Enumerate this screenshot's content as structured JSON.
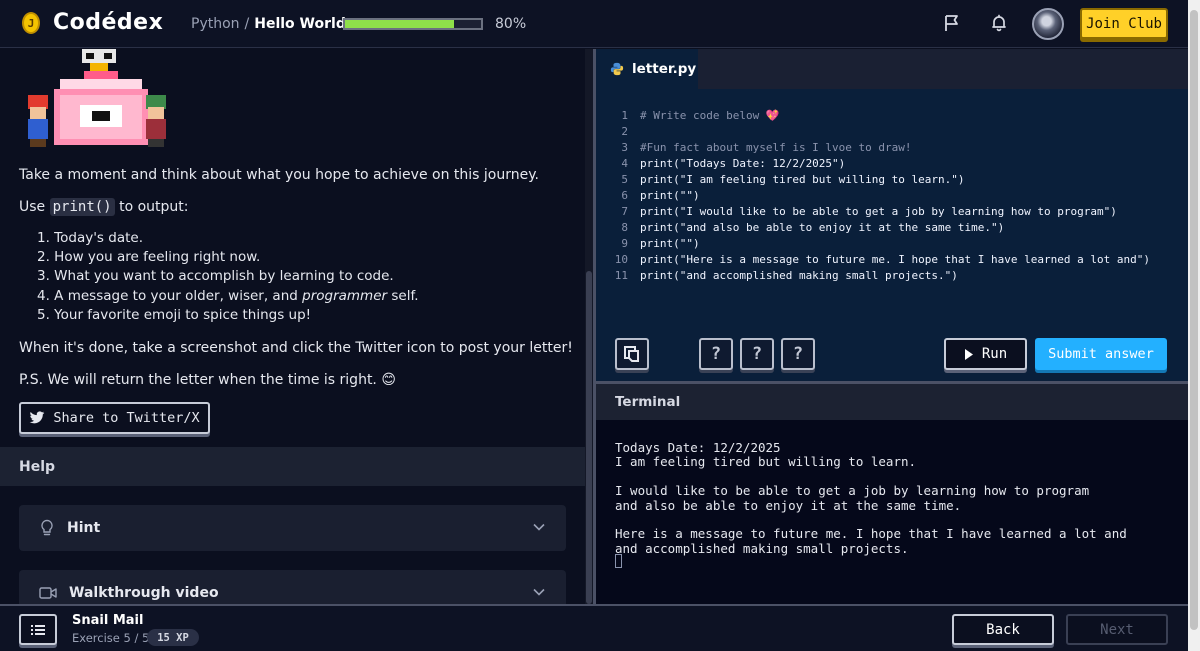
{
  "header": {
    "logo_letter": "J",
    "logo_text": "Codédex",
    "breadcrumb": {
      "course": "Python",
      "separator": "/",
      "lesson": "Hello World"
    },
    "progress": {
      "percent": 80,
      "label": "80%"
    },
    "join_label": "Join Club",
    "icons": [
      "flag-icon",
      "bell-icon"
    ]
  },
  "lesson": {
    "intro": "Take a moment and think about what you hope to achieve on this journey.",
    "use_prefix": "Use ",
    "use_code": "print()",
    "use_suffix": " to output:",
    "items": [
      "1. Today's date.",
      "2. How you are feeling right now.",
      "3. What you want to accomplish by learning to code.",
      "5. Your favorite emoji to spice things up!"
    ],
    "item4_prefix": "4. A message to your older, wiser, and ",
    "item4_em": "programmer",
    "item4_suffix": " self.",
    "done_text": "When it's done, take a screenshot and click the Twitter icon to post your letter!",
    "ps_text": "P.S. We will return the letter when the time is right. 😊",
    "share_label": "Share to Twitter/X",
    "help_label": "Help",
    "hint_label": "Hint",
    "video_label": "Walkthrough video"
  },
  "editor": {
    "filename": "letter.py",
    "lines": [
      {
        "n": "1",
        "text": "# Write code below 💖",
        "kind": "cmt"
      },
      {
        "n": "2",
        "text": "",
        "kind": "cmt"
      },
      {
        "n": "3",
        "text": "#Fun fact about myself is I lvoe to draw!",
        "kind": "cmt"
      },
      {
        "n": "4",
        "text": "print(\"Todays Date: 12/2/2025\")",
        "kind": "code"
      },
      {
        "n": "5",
        "text": "print(\"I am feeling tired but willing to learn.\")",
        "kind": "code"
      },
      {
        "n": "6",
        "text": "print(\"\")",
        "kind": "code"
      },
      {
        "n": "7",
        "text": "print(\"I would like to be able to get a job by learning how to program\")",
        "kind": "code"
      },
      {
        "n": "8",
        "text": "print(\"and also be able to enjoy it at the same time.\")",
        "kind": "code"
      },
      {
        "n": "9",
        "text": "print(\"\")",
        "kind": "code"
      },
      {
        "n": "10",
        "text": "print(\"Here is a message to future me. I hope that I have learned a lot and\")",
        "kind": "code"
      },
      {
        "n": "11",
        "text": "print(\"and accomplished making small projects.\")",
        "kind": "code"
      }
    ],
    "help_glyph": "?",
    "run_label": "Run",
    "submit_label": "Submit answer"
  },
  "terminal": {
    "title": "Terminal",
    "output": [
      "Todays Date: 12/2/2025",
      "I am feeling tired but willing to learn.",
      "",
      "I would like to be able to get a job by learning how to program",
      "and also be able to enjoy it at the same time.",
      "",
      "Here is a message to future me. I hope that I have learned a lot and",
      "and accomplished making small projects."
    ]
  },
  "footer": {
    "exercise_title": "Snail Mail",
    "exercise_sub": "Exercise 5 / 5",
    "xp": "15 XP",
    "back_label": "Back",
    "next_label": "Next"
  },
  "colors": {
    "accent_yellow": "#ffd028",
    "accent_blue": "#23b0ff",
    "progress_green": "#8fe04a",
    "editor_bg": "#0a1f3a"
  }
}
